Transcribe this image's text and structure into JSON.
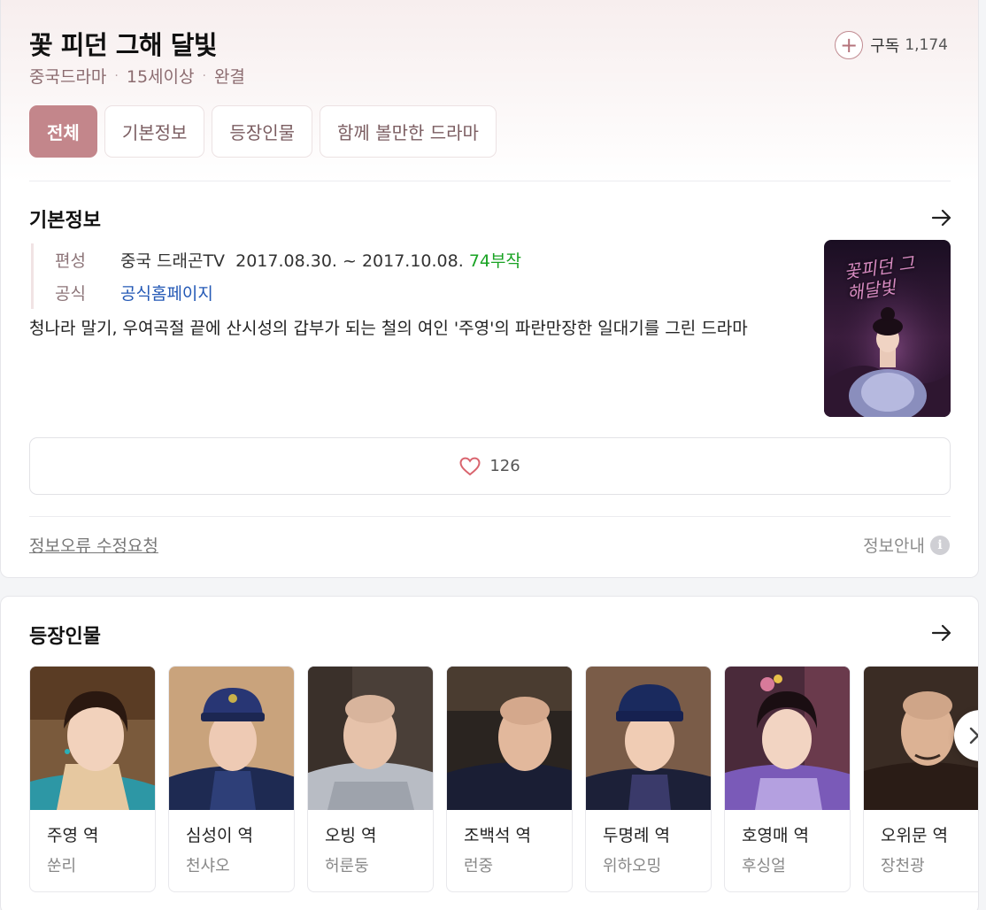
{
  "drama": {
    "title": "꽃 피던 그해 달빛",
    "genre": "중국드라마",
    "rating": "15세이상",
    "status": "완결"
  },
  "subscribe": {
    "label": "구독",
    "count": "1,174",
    "icon": "plus-icon"
  },
  "tabs": [
    {
      "label": "전체",
      "active": true
    },
    {
      "label": "기본정보",
      "active": false
    },
    {
      "label": "등장인물",
      "active": false
    },
    {
      "label": "함께 볼만한 드라마",
      "active": false
    }
  ],
  "basic_info": {
    "section_title": "기본정보",
    "broadcast_key": "편성",
    "broadcast_value": "중국 드래곤TV  2017.08.30. ~ 2017.10.08.",
    "episodes": "74부작",
    "official_key": "공식",
    "official_value": "공식홈페이지",
    "description": "청나라 말기, 우여곡절 끝에 산시성의 갑부가 되는 철의 여인 '주영'의 파란만장한 일대기를 그린 드라마",
    "poster_text": "꽃피던 그해달빛"
  },
  "like": {
    "count": "126",
    "icon": "heart-icon"
  },
  "footer": {
    "report": "정보오류 수정요청",
    "guide": "정보안내",
    "guide_icon": "info-icon",
    "guide_icon_glyph": "i"
  },
  "cast_section": {
    "title": "등장인물",
    "people": [
      {
        "role": "주영 역",
        "actor": "쑨리"
      },
      {
        "role": "심성이 역",
        "actor": "천샤오"
      },
      {
        "role": "오빙 역",
        "actor": "허룬둥"
      },
      {
        "role": "조백석 역",
        "actor": "런중"
      },
      {
        "role": "두명례 역",
        "actor": "위하오밍"
      },
      {
        "role": "호영매 역",
        "actor": "후싱얼"
      },
      {
        "role": "오위문 역",
        "actor": "장천광"
      }
    ]
  },
  "colors": {
    "accent": "#c3868b",
    "link": "#2358b5",
    "episodes": "#19a323"
  }
}
